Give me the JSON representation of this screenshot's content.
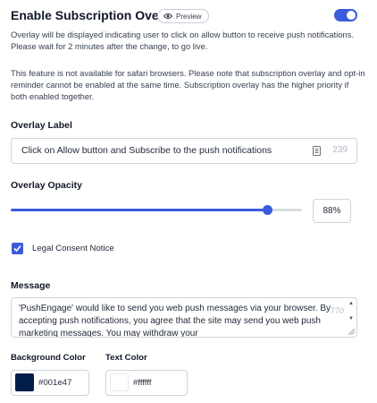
{
  "header": {
    "title": "Enable Subscription Overlay",
    "preview_label": "Preview",
    "toggle_on": true
  },
  "description": {
    "line1": "Overlay will be displayed indicating user to click on allow button to receive push notifications. Please wait for 2 minutes after the change, to go live.",
    "line2": "This feature is not available for safari browsers. Please note that subscription overlay and opt-in reminder cannot be enabled at the same time. Subscription overlay has the higher priority if both enabled together."
  },
  "overlay_label": {
    "label": "Overlay Label",
    "value": "Click on Allow button and Subscribe to the push notifications",
    "remaining_chars": "239"
  },
  "overlay_opacity": {
    "label": "Overlay Opacity",
    "value": 0.88,
    "display": "88%"
  },
  "legal_consent": {
    "label": "Legal Consent Notice",
    "checked": true
  },
  "message": {
    "label": "Message",
    "value": "'PushEngage' would like to send you web push messages via your browser. By accepting push notifications, you agree that the site may send you web push marketing messages. You may withdraw your",
    "remaining_chars": "770"
  },
  "background_color": {
    "label": "Background Color",
    "value": "#001e47"
  },
  "text_color": {
    "label": "Text Color",
    "value": "#ffffff"
  },
  "colors": {
    "accent": "#3b5bdb",
    "background_swatch": "#001e47",
    "text_swatch": "#ffffff"
  }
}
